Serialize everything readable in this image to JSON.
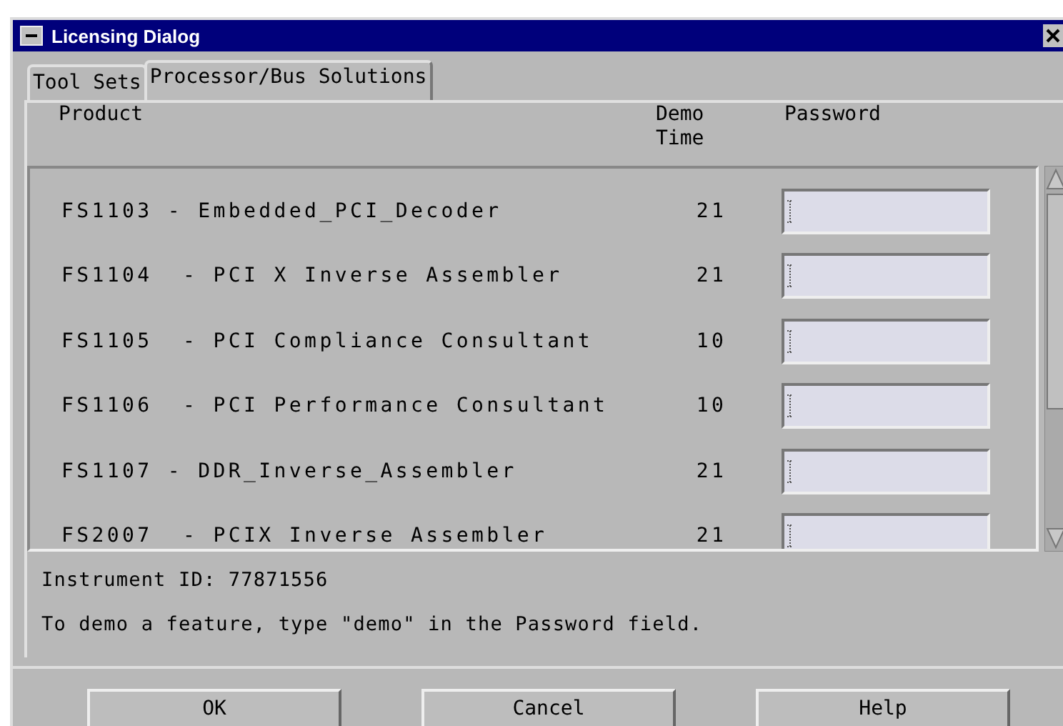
{
  "window": {
    "title": "Licensing Dialog"
  },
  "tabs": [
    {
      "label": "Tool Sets",
      "selected": false
    },
    {
      "label": "Processor/Bus Solutions",
      "selected": true
    }
  ],
  "table": {
    "columns": [
      "Product",
      "Demo\nTime",
      "Password"
    ],
    "rows": [
      {
        "product": "FS1103 - Embedded_PCI_Decoder",
        "demo_time": "21"
      },
      {
        "product": "FS1104  - PCI X Inverse Assembler",
        "demo_time": "21"
      },
      {
        "product": "FS1105  - PCI Compliance Consultant",
        "demo_time": "10"
      },
      {
        "product": "FS1106  - PCI Performance Consultant",
        "demo_time": "10"
      },
      {
        "product": "FS1107 - DDR_Inverse_Assembler",
        "demo_time": "21"
      },
      {
        "product": "FS2007  - PCIX Inverse Assembler",
        "demo_time": "21"
      }
    ]
  },
  "instrument_id": "Instrument ID: 77871556",
  "hint": "To demo a feature, type \"demo\" in the Password field.",
  "buttons": [
    "OK",
    "Cancel",
    "Help"
  ]
}
